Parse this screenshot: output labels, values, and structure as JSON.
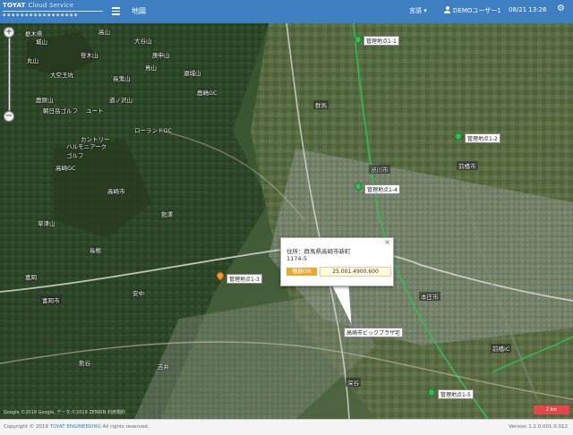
{
  "header": {
    "brand_title": "TOYAT",
    "brand_subtitle": "Cloud Service",
    "brand_dots": "▪▪▪▪▪▪▪▪▪▪▪▪▪▪▪▪▪",
    "page_title": "地図",
    "language_label": "言語 ▾",
    "user_label": "DEMOユーザー1",
    "datetime": "08/21 13:26",
    "menu_icon": "hamburger-icon",
    "settings_icon": "gear-icon",
    "accent_color": "#3d7fc0"
  },
  "map": {
    "place_labels": [
      "栃木県",
      "城山",
      "高山",
      "大谷山",
      "笹木山",
      "庚申山",
      "丸山",
      "大空王坑",
      "鳥山",
      "遠城山",
      "長鬼山",
      "道ノ沢山",
      "鹿原山",
      "朝日岳ゴルフ",
      "鹿嶋GC",
      "ユート",
      "ローランドGC",
      "カントリー",
      "ハルモニアーク",
      "ゴルフ",
      "高崎GC",
      "高崎市",
      "群馬",
      "前橋市",
      "渋川市",
      "草津山",
      "熊澤",
      "富岡",
      "長根",
      "富岡市",
      "安中",
      "前橋IC",
      "本庄市",
      "熊谷",
      "吉井",
      "深谷"
    ],
    "markers": [
      {
        "color": "green",
        "label": "管理地点1-1"
      },
      {
        "color": "green",
        "label": "管理地点1-2"
      },
      {
        "color": "orange",
        "label": "管理地点1-3"
      },
      {
        "color": "green",
        "label": "管理地点1-4"
      },
      {
        "color": "green",
        "label": "管理地点1-5"
      }
    ],
    "popup": {
      "address_label": "住所：群馬県高崎市新町",
      "address_line2": "1174-5",
      "status_tag": "機器ON",
      "value": "25.001.4900.600",
      "close": "×"
    },
    "location_label": "高崎市ビックプラザ宅",
    "attribution": "Google ©2019 Google, データ:©2019 ZENRIN 利用規約",
    "scale_label": "2 km",
    "zoom_in": "+",
    "zoom_out": "−"
  },
  "footer": {
    "copyright_prefix": "Copyright © 2019",
    "company": "TOYAT ENGINEERING",
    "copyright_suffix": "All rights reserved.",
    "version": "Version 1.2.0.001.0.012"
  }
}
